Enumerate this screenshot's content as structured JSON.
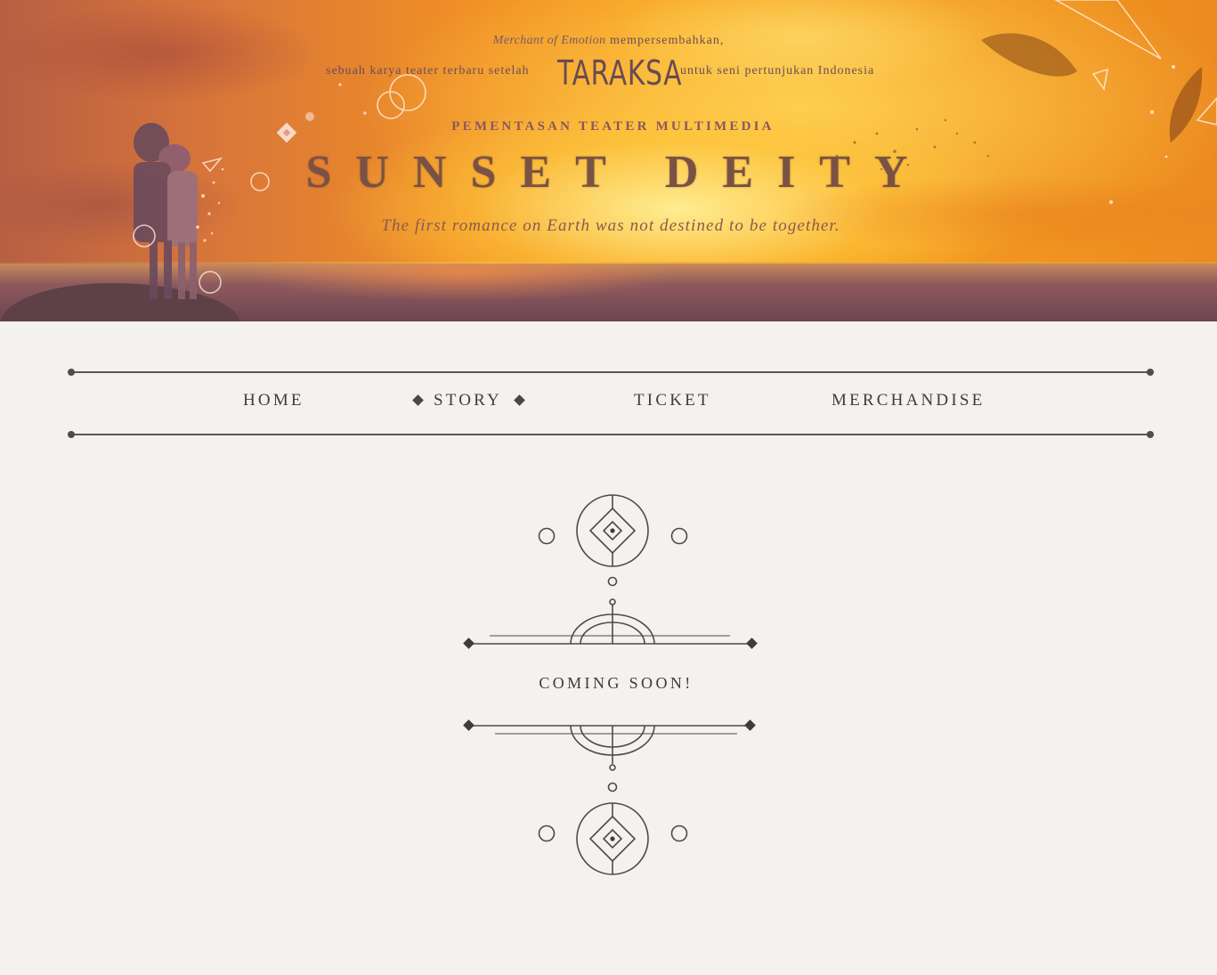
{
  "hero": {
    "merchant": "Merchant of Emotion",
    "presents": "mempersembahkan,",
    "line2_left": "sebuah karya teater terbaru setelah",
    "taraksa": "TARAKSA",
    "line2_right": "untuk seni pertunjukan Indonesia",
    "kicker": "PEMENTASAN TEATER MULTIMEDIA",
    "title": "SUNSET DEITY",
    "tagline": "The first romance on Earth was not destined to be together."
  },
  "nav": {
    "home": "HOME",
    "story": "STORY",
    "ticket": "TICKET",
    "merchandise": "MERCHANDISE",
    "active": "story"
  },
  "main": {
    "status": "COMING SOON!"
  },
  "colors": {
    "background": "#f4f2ee",
    "ink": "#3f3d3c",
    "hero_title": "#7a5245"
  }
}
